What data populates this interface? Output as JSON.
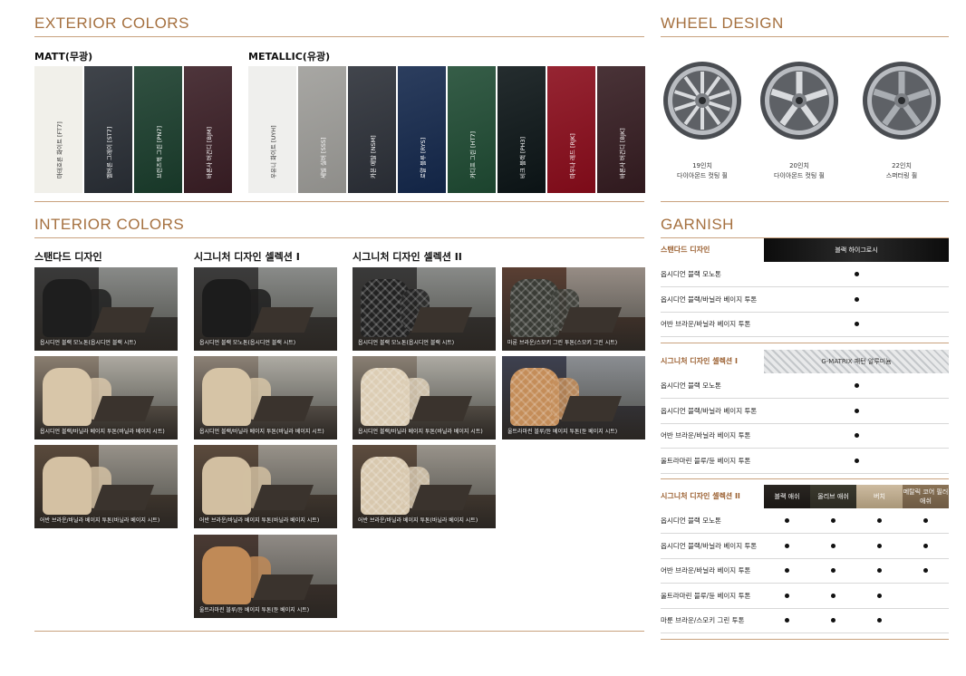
{
  "exterior": {
    "title": "EXTERIOR COLORS",
    "matt_title": "MATT(무광)",
    "metallic_title": "METALLIC(유광)",
    "matt": [
      {
        "label": "마테호른 화이트 [FT7]",
        "color": "#f1f0ea",
        "light": true
      },
      {
        "label": "멜버른 그레이 [ST7]",
        "color": "#2a2f36"
      },
      {
        "label": "브런즈윅 그린 [PN7]",
        "color": "#1a3d2c"
      },
      {
        "label": "바론사 버건디 [BJM]",
        "color": "#3a1e25"
      }
    ],
    "metallic": [
      {
        "label": "우유니 화이트 [UYH]",
        "color": "#efefed",
        "light": true
      },
      {
        "label": "세빌 실버 [SSS]",
        "color": "#9e9d99"
      },
      {
        "label": "카본 메탈 [NSM]",
        "color": "#2c3038"
      },
      {
        "label": "로얄 블루 [RYS]",
        "color": "#14284c"
      },
      {
        "label": "카디프 그린 [HT7]",
        "color": "#1f4b33"
      },
      {
        "label": "비크 블랙 [PH3]",
        "color": "#0c1517"
      },
      {
        "label": "마우나 레드 [RJK]",
        "color": "#8a0c1b"
      },
      {
        "label": "바론사 버건디 [BJK]",
        "color": "#351c21"
      }
    ]
  },
  "wheels": {
    "title": "WHEEL DESIGN",
    "items": [
      {
        "size": "19인치",
        "name": "다이아몬드 컷팅 휠"
      },
      {
        "size": "20인치",
        "name": "다이아몬드 컷팅 휠"
      },
      {
        "size": "22인치",
        "name": "스퍼터링 휠"
      }
    ]
  },
  "interior": {
    "title": "INTERIOR COLORS",
    "columns": [
      {
        "title": "스탠다드 디자인"
      },
      {
        "title": "시그니처 디자인 셀렉션 I"
      },
      {
        "title": "시그니처 디자인 셀렉션 II"
      }
    ],
    "photos": [
      {
        "cap": "옵시디언 블랙 모노톤(옵시디언 블랙 시트)",
        "seat": "#1e1e1e",
        "bg": "#3a3a3a",
        "quilt": false
      },
      {
        "cap": "옵시디언 블랙/바닐라 베이지 투톤(바닐라 베이지 시트)",
        "seat": "#d8c6a9",
        "bg": "#8a7e70",
        "quilt": false
      },
      {
        "cap": "어반 브라운/바닐라 베이지 투톤(바닐라 베이지 시트)",
        "seat": "#d4c1a3",
        "bg": "#5a4a3c",
        "quilt": false
      },
      {
        "cap": "옵시디언 블랙 모노톤(옵시디언 블랙 시트)",
        "seat": "#1c1c1c",
        "bg": "#3c3c3c",
        "quilt": false
      },
      {
        "cap": "옵시디언 블랙/바닐라 베이지 투톤(바닐라 베이지 시트)",
        "seat": "#d6c4a6",
        "bg": "#8c8276",
        "quilt": false
      },
      {
        "cap": "어반 브라운/바닐라 베이지 투톤(바닐라 베이지 시트)",
        "seat": "#d2bfa1",
        "bg": "#5c4b3d",
        "quilt": false
      },
      {
        "cap": "울트라마린 블루/듄 베이지 투톤(듄 베이지 시트)",
        "seat": "#c08a57",
        "bg": "#4a3a33",
        "quilt": false
      },
      {
        "cap": "옵시디언 블랙 모노톤(옵시디언 블랙 시트)",
        "seat": "#222222",
        "bg": "#3a3a3a",
        "quilt": true
      },
      {
        "cap": "옵시디언 블랙/바닐라 베이지 투톤(바닐라 베이지 시트)",
        "seat": "#dccdb4",
        "bg": "#8a8074",
        "quilt": true
      },
      {
        "cap": "어반 브라운/바닐라 베이지 투톤(바닐라 베이지 시트)",
        "seat": "#d8c8ae",
        "bg": "#5e4d3f",
        "quilt": true
      },
      {
        "cap": "마룬 브라운/스모키 그린 투톤(스모키 그린 시트)",
        "seat": "#3a3c36",
        "bg": "#5a3f33",
        "quilt": true
      },
      {
        "cap": "울트라마린 블루/듄 베이지 투톤(듄 베이지 시트)",
        "seat": "#c48d59",
        "bg": "#3e4150",
        "quilt": true
      }
    ]
  },
  "garnish": {
    "title": "GARNISH",
    "groups": [
      {
        "name": "스탠다드 디자인",
        "headers": [
          "블랙 하이그로시"
        ],
        "rows": [
          {
            "label": "옵시디언 블랙 모노톤",
            "marks": [
              true
            ]
          },
          {
            "label": "옵시디언 블랙/바닐라 베이지 투톤",
            "marks": [
              true
            ]
          },
          {
            "label": "어반 브라운/바닐라 베이지 투톤",
            "marks": [
              true
            ]
          }
        ]
      },
      {
        "name": "시그니처 디자인 셀렉션 I",
        "headers": [
          "G-MATRIX 패턴 알루미늄"
        ],
        "rows": [
          {
            "label": "옵시디언 블랙 모노톤",
            "marks": [
              true
            ]
          },
          {
            "label": "옵시디언 블랙/바닐라 베이지 투톤",
            "marks": [
              true
            ]
          },
          {
            "label": "어반 브라운/바닐라 베이지 투톤",
            "marks": [
              true
            ]
          },
          {
            "label": "울트라마린 블루/듄 베이지 투톤",
            "marks": [
              true
            ]
          }
        ]
      },
      {
        "name": "시그니처 디자인 셀렉션 II",
        "headers": [
          "블랙 애쉬",
          "올리브 애쉬",
          "버치",
          "메탈릭 코어 필러 애쉬"
        ],
        "rows": [
          {
            "label": "옵시디언 블랙 모노톤",
            "marks": [
              true,
              true,
              true,
              true
            ]
          },
          {
            "label": "옵시디언 블랙/바닐라 베이지 투톤",
            "marks": [
              true,
              true,
              true,
              true
            ]
          },
          {
            "label": "어반 브라운/바닐라 베이지 투톤",
            "marks": [
              true,
              true,
              true,
              true
            ]
          },
          {
            "label": "울트라마린 블루/듄 베이지 투톤",
            "marks": [
              true,
              true,
              true,
              false
            ]
          },
          {
            "label": "마룬 브라운/스모키 그린 투톤",
            "marks": [
              true,
              true,
              true,
              false
            ]
          }
        ]
      }
    ]
  }
}
